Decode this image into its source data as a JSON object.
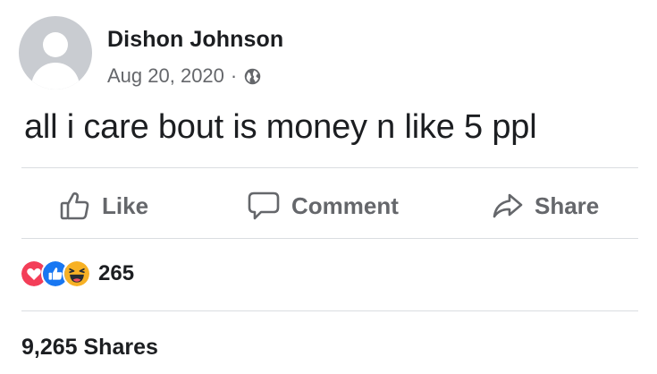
{
  "post": {
    "author": "Dishon Johnson",
    "date": "Aug 20, 2020",
    "separator": "·",
    "visibility_icon": "globe-icon",
    "text": "all i care bout is money n like 5 ppl"
  },
  "actions": {
    "like_label": "Like",
    "comment_label": "Comment",
    "share_label": "Share"
  },
  "reactions": {
    "icons": [
      "love-reaction-icon",
      "like-reaction-icon",
      "haha-reaction-icon"
    ],
    "count": "265"
  },
  "shares": {
    "label": "9,265 Shares"
  },
  "colors": {
    "text_primary": "#1c1e21",
    "text_secondary": "#65676b",
    "divider": "#dadde1",
    "love": "#f33e58",
    "like": "#1877f2",
    "haha": "#f7b125"
  }
}
